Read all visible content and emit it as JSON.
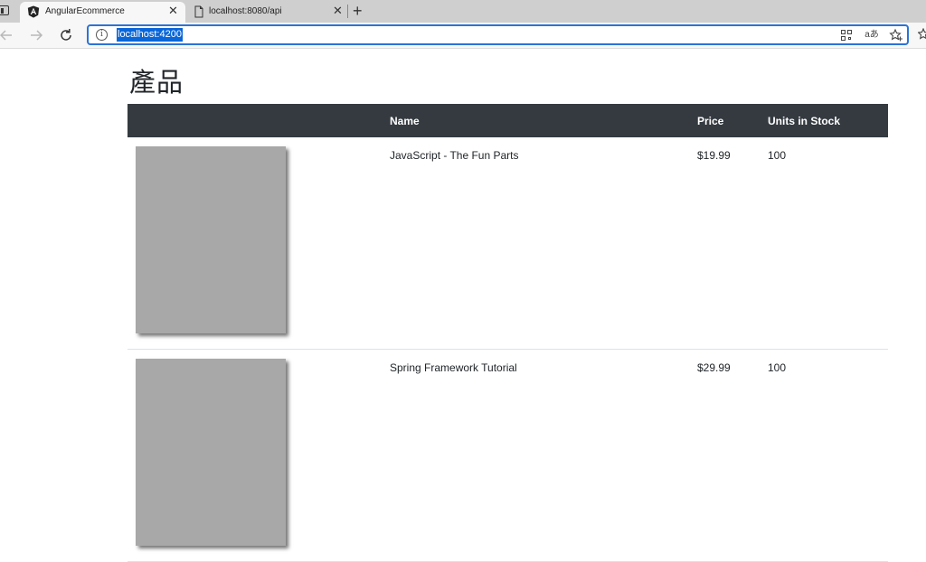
{
  "browser": {
    "tabs": [
      {
        "title": "AngularEcommerce",
        "favicon": "angular-logo-icon",
        "active": true
      },
      {
        "title": "localhost:8080/api",
        "favicon": "document-icon",
        "active": false
      }
    ],
    "close_glyph": "✕",
    "new_tab_glyph": "+",
    "address": "localhost:4200",
    "info_glyph": "i",
    "read_aloud_glyph": "aあ"
  },
  "page": {
    "title": "產品",
    "columns": {
      "image": "",
      "name": "Name",
      "price": "Price",
      "stock": "Units in Stock"
    },
    "products": [
      {
        "name": "JavaScript - The Fun Parts",
        "price": "$19.99",
        "stock": "100"
      },
      {
        "name": "Spring Framework Tutorial",
        "price": "$29.99",
        "stock": "100"
      }
    ]
  },
  "colors": {
    "header_bg": "#343a40",
    "address_focus": "#2b73d6",
    "url_highlight": "#0a66d8",
    "placeholder_image": "#a8a8a8"
  }
}
